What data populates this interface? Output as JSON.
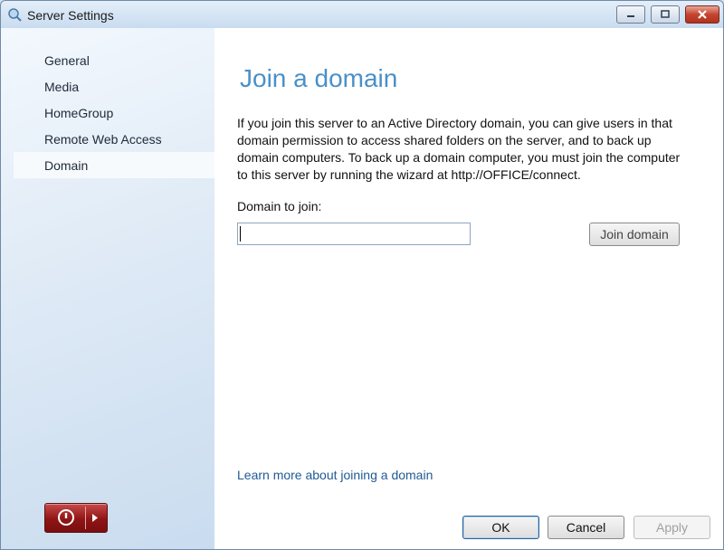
{
  "window": {
    "title": "Server Settings",
    "icon": "search-gear-icon"
  },
  "caption_buttons": {
    "minimize_icon": "minimize-icon",
    "maximize_icon": "maximize-icon",
    "close_icon": "close-icon"
  },
  "sidebar": {
    "items": [
      {
        "label": "General",
        "selected": false
      },
      {
        "label": "Media",
        "selected": false
      },
      {
        "label": "HomeGroup",
        "selected": false
      },
      {
        "label": "Remote Web Access",
        "selected": false
      },
      {
        "label": "Domain",
        "selected": true
      }
    ],
    "power_icon": "power-icon",
    "arrow_icon": "play-arrow-icon"
  },
  "main": {
    "heading": "Join a domain",
    "description": "If you join this server to an Active Directory domain, you can give users in that domain permission to access shared folders on the server, and to back up domain computers. To back up a domain computer, you must join the computer to this server by running the wizard at http://OFFICE/connect.",
    "field_label": "Domain to join:",
    "domain_value": "",
    "join_button": "Join domain",
    "learn_more_link": "Learn more about joining a domain"
  },
  "footer": {
    "ok": "OK",
    "cancel": "Cancel",
    "apply": "Apply"
  },
  "colors": {
    "heading": "#4a90c8",
    "link": "#1f5a95",
    "power_button": "#8f1515",
    "sidebar_bg": "#dfeaf6"
  }
}
